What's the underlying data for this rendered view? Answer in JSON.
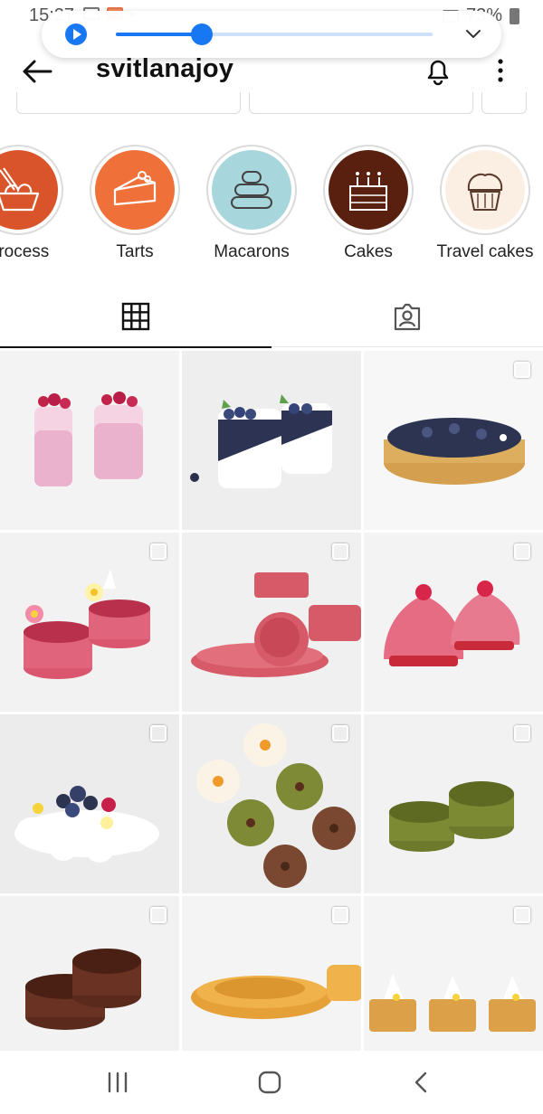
{
  "status_bar": {
    "time": "15:27",
    "battery": "73%"
  },
  "media_player": {
    "progress": 0.27
  },
  "header": {
    "username": "svitlanajoy"
  },
  "highlights": [
    {
      "label": "Process",
      "color": "#d9542b",
      "icon": "whisk-bowl-icon"
    },
    {
      "label": "Tarts",
      "color": "#f0703a",
      "icon": "tart-slice-icon"
    },
    {
      "label": "Macarons",
      "color": "#a7d6dc",
      "icon": "macaron-stack-icon"
    },
    {
      "label": "Cakes",
      "color": "#5a200f",
      "icon": "birthday-cake-icon"
    },
    {
      "label": "Travel cakes",
      "color": "#fbeee2",
      "icon": "muffin-icon"
    }
  ],
  "tabs": [
    {
      "name": "posts",
      "icon": "grid-icon",
      "active": true
    },
    {
      "name": "tagged",
      "icon": "tagged-person-icon",
      "active": false
    }
  ],
  "posts": [
    {
      "subject": "raspberry-mousse-glasses",
      "multi": false
    },
    {
      "subject": "blueberry-panna-cotta",
      "multi": false
    },
    {
      "subject": "blueberry-tart",
      "multi": true
    },
    {
      "subject": "pink-tartlets-with-flowers",
      "multi": true
    },
    {
      "subject": "pink-tart-shells",
      "multi": true
    },
    {
      "subject": "pink-domes",
      "multi": true
    },
    {
      "subject": "meringue-berry-cake",
      "multi": true
    },
    {
      "subject": "linzer-cookies",
      "multi": true
    },
    {
      "subject": "green-tart-rings",
      "multi": true
    },
    {
      "subject": "chocolate-tart-rings",
      "multi": true
    },
    {
      "subject": "golden-tart-ring",
      "multi": true
    },
    {
      "subject": "meringue-mini-tarts",
      "multi": true
    }
  ],
  "nav": [
    "recent-apps-icon",
    "home-icon",
    "back-icon"
  ]
}
